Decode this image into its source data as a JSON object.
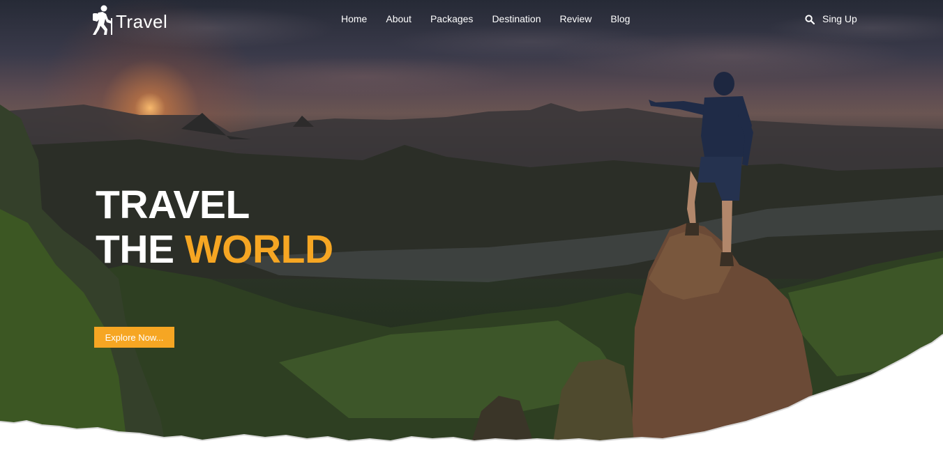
{
  "brand": {
    "name": "Travel",
    "icon": "hiker-icon"
  },
  "nav": {
    "items": [
      {
        "label": "Home"
      },
      {
        "label": "About"
      },
      {
        "label": "Packages"
      },
      {
        "label": "Destination"
      },
      {
        "label": "Review"
      },
      {
        "label": "Blog"
      }
    ],
    "search_icon": "search-icon",
    "signup_label": "Sing Up"
  },
  "hero": {
    "line1": "TRAVEL",
    "line2_prefix": "THE",
    "line2_accent": "WORLD",
    "cta_label": "Explore Now...",
    "accent_color": "#f6a623"
  }
}
